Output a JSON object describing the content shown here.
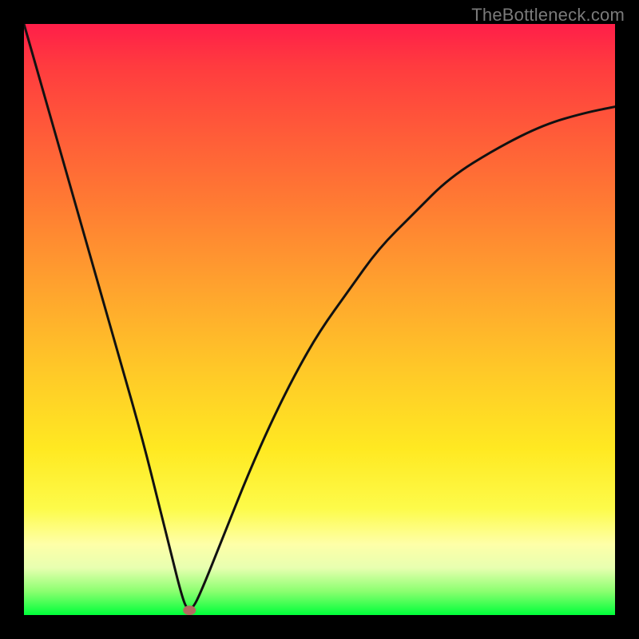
{
  "watermark": "TheBottleneck.com",
  "chart_data": {
    "type": "line",
    "title": "",
    "xlabel": "",
    "ylabel": "",
    "xlim": [
      0,
      100
    ],
    "ylim": [
      0,
      100
    ],
    "grid": false,
    "legend": false,
    "gradient_stops": [
      {
        "pct": 0,
        "color": "#ff1e49"
      },
      {
        "pct": 18,
        "color": "#ff5a39"
      },
      {
        "pct": 44,
        "color": "#ffa12e"
      },
      {
        "pct": 72,
        "color": "#ffe922"
      },
      {
        "pct": 88,
        "color": "#feffa8"
      },
      {
        "pct": 96,
        "color": "#8bff70"
      },
      {
        "pct": 100,
        "color": "#00ff3a"
      }
    ],
    "series": [
      {
        "name": "bottleneck-curve",
        "x": [
          0,
          4,
          8,
          12,
          16,
          20,
          23,
          25,
          26.5,
          27.5,
          28.5,
          30,
          34,
          38,
          42,
          46,
          50,
          55,
          60,
          66,
          72,
          80,
          88,
          95,
          100
        ],
        "values": [
          100,
          86,
          72,
          58,
          44,
          30,
          18,
          10,
          4,
          1,
          1,
          4,
          14,
          24,
          33,
          41,
          48,
          55,
          62,
          68,
          74,
          79,
          83,
          85,
          86
        ]
      }
    ],
    "marker": {
      "x": 28,
      "y": 0.8,
      "label": "optimal-point"
    }
  }
}
